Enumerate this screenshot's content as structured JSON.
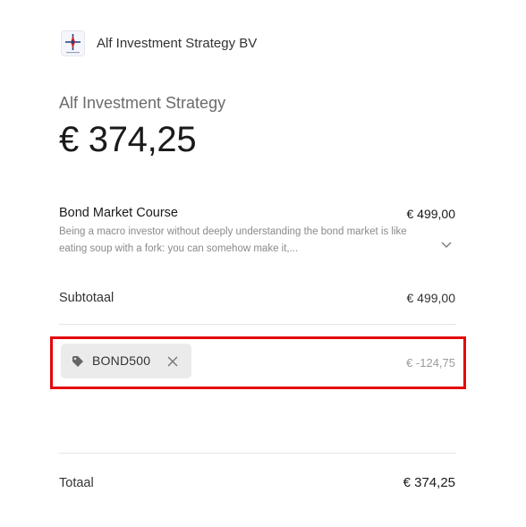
{
  "merchant": {
    "name": "Alf Investment Strategy BV",
    "logo_icon": "compass-star-logo"
  },
  "summary": {
    "store_name": "Alf Investment Strategy",
    "total": "€ 374,25"
  },
  "line_item": {
    "name": "Bond Market Course",
    "price": "€ 499,00",
    "description": "Being a macro investor without deeply understanding the bond market is like eating soup with a fork: you can somehow make it,...",
    "expand_icon": "chevron-down-icon"
  },
  "subtotal": {
    "label": "Subtotaal",
    "value": "€ 499,00"
  },
  "promotion": {
    "code": "BOND500",
    "tag_icon": "tag-icon",
    "remove_icon": "close-icon",
    "discount": "€ -124,75",
    "highlight_color": "#e3080c"
  },
  "total": {
    "label": "Totaal",
    "value": "€ 374,25"
  }
}
